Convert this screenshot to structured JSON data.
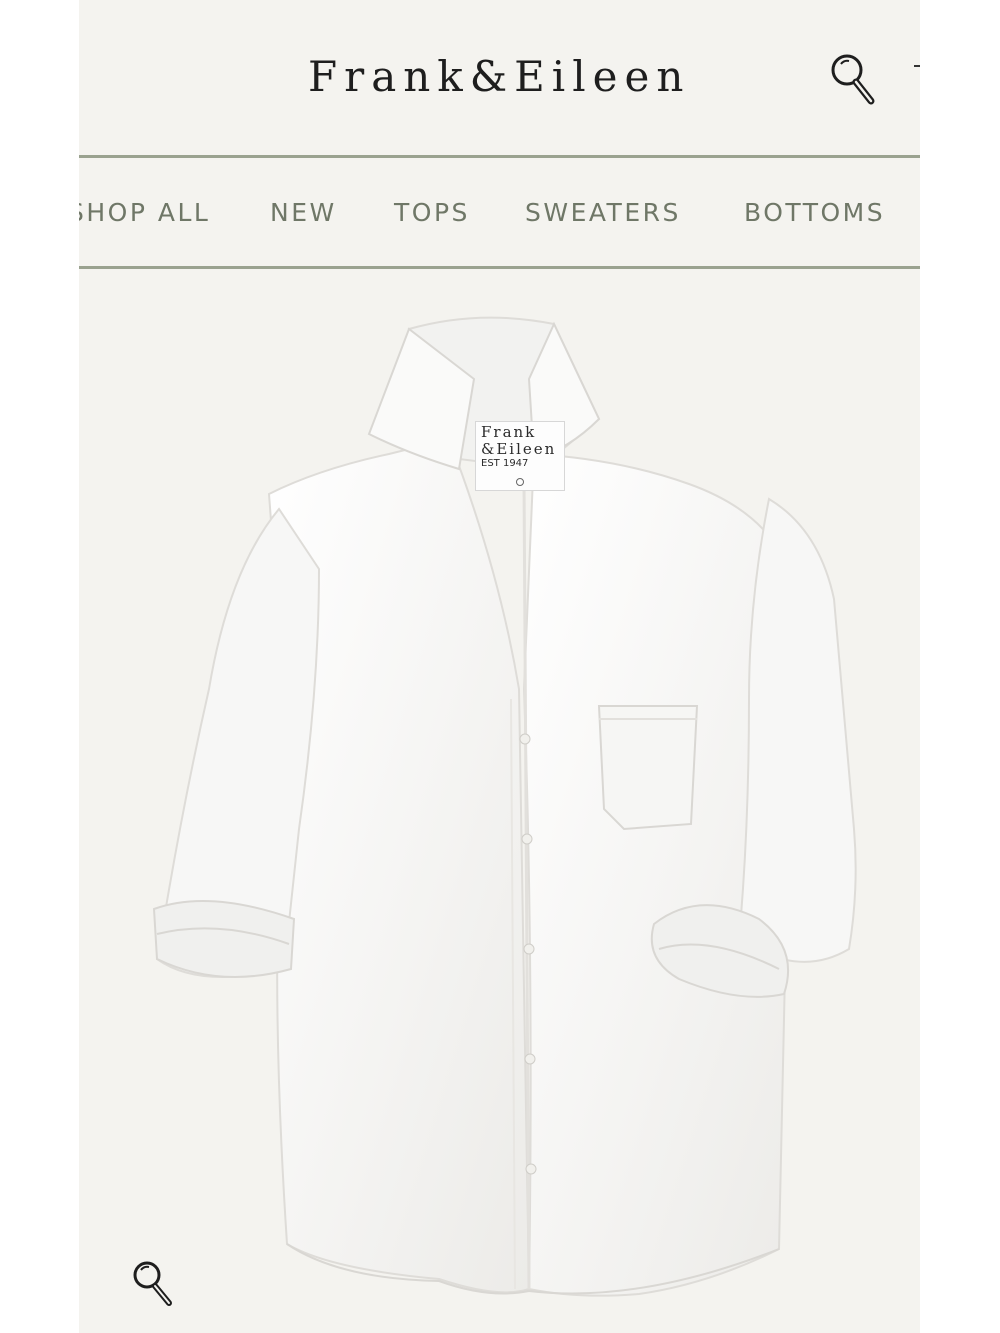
{
  "header": {
    "logo_text": "Frank&Eileen",
    "search_icon": "magnifier-icon"
  },
  "nav": {
    "items": [
      {
        "label": "SHOP ALL"
      },
      {
        "label": "NEW"
      },
      {
        "label": "TOPS"
      },
      {
        "label": "SWEATERS"
      },
      {
        "label": "BOTTOMS"
      }
    ]
  },
  "product": {
    "label_line1": "Frank",
    "label_line2": "&Eileen",
    "label_line3": "EST 1947",
    "zoom_icon": "magnifier-icon"
  },
  "colors": {
    "background": "#f4f3ef",
    "rule": "#9aa28f",
    "nav_text": "#6f7767",
    "logo_text": "#1e1e1e"
  }
}
